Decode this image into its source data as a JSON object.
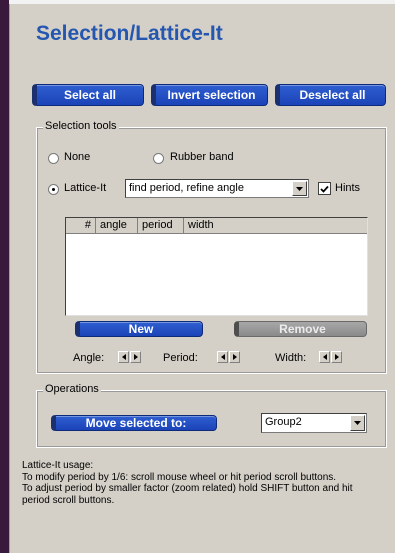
{
  "title": "Selection/Lattice-It",
  "top_buttons": {
    "select_all": "Select all",
    "invert_selection": "Invert selection",
    "deselect_all": "Deselect all"
  },
  "selection_tools": {
    "legend": "Selection tools",
    "radio_none": "None",
    "radio_rubber_band": "Rubber band",
    "radio_lattice_it": "Lattice-It",
    "selected_tool": "Lattice-It",
    "mode_value": "find period, refine angle",
    "hints_label": "Hints",
    "hints_checked": true,
    "table_headers": [
      "#",
      "angle",
      "period",
      "width"
    ],
    "table_rows": [],
    "new_button": "New",
    "remove_button": "Remove",
    "angle_label": "Angle:",
    "period_label": "Period:",
    "width_label": "Width:"
  },
  "operations": {
    "legend": "Operations",
    "move_button": "Move selected to:",
    "group_value": "Group2"
  },
  "help": {
    "line1": "Lattice-It usage:",
    "line2": "To modify period by 1/6: scroll mouse wheel or hit period scroll buttons.",
    "line3": "To adjust period by smaller factor (zoom related) hold SHIFT button and hit period scroll buttons."
  },
  "colors": {
    "panel_bg": "#d4d0c8",
    "title_blue": "#2556b0",
    "button_blue": "#1b43b8",
    "button_disabled": "#8a8a8a",
    "left_strip": "#3a1a3c"
  },
  "icons": {
    "dropdown": "chevron-down-icon",
    "spin_left": "arrow-left-icon",
    "spin_right": "arrow-right-icon",
    "check": "check-icon"
  }
}
